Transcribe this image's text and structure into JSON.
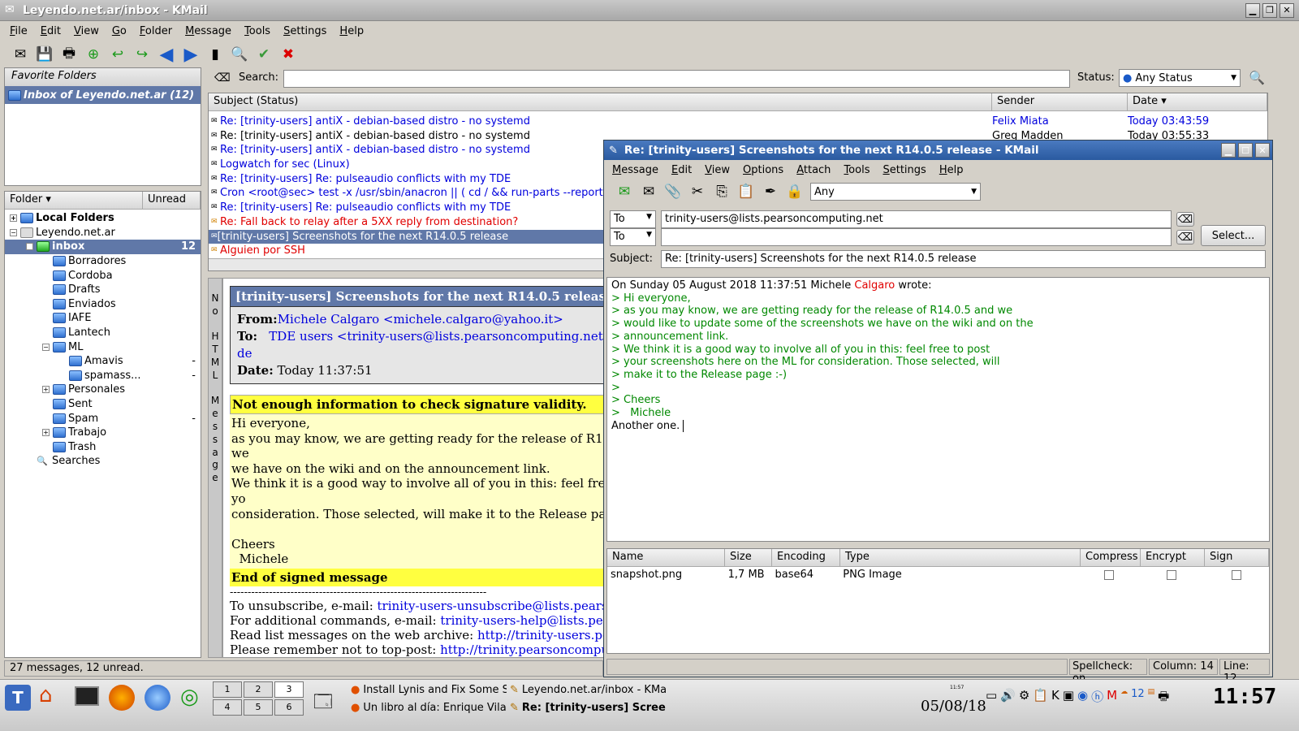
{
  "main_window": {
    "title": "Leyendo.net.ar/inbox - KMail",
    "menu": [
      "File",
      "Edit",
      "View",
      "Go",
      "Folder",
      "Message",
      "Tools",
      "Settings",
      "Help"
    ],
    "favorites_header": "Favorite Folders",
    "favorite_inbox": "Inbox of Leyendo.net.ar  (12)",
    "search_label": "Search:",
    "search_value": "",
    "status_label": "Status:",
    "status_value": "Any Status",
    "folder_header": "Folder",
    "unread_header": "Unread",
    "folders": [
      {
        "name": "Local Folders",
        "level": 0,
        "expander": "+",
        "unread": ""
      },
      {
        "name": "Leyendo.net.ar",
        "level": 0,
        "expander": "−",
        "unread": ""
      },
      {
        "name": "inbox",
        "level": 1,
        "expander": "−",
        "unread": "12"
      },
      {
        "name": "Borradores",
        "level": 2,
        "expander": "",
        "unread": ""
      },
      {
        "name": "Cordoba",
        "level": 2,
        "expander": "",
        "unread": ""
      },
      {
        "name": "Drafts",
        "level": 2,
        "expander": "",
        "unread": ""
      },
      {
        "name": "Enviados",
        "level": 2,
        "expander": "",
        "unread": ""
      },
      {
        "name": "IAFE",
        "level": 2,
        "expander": "",
        "unread": ""
      },
      {
        "name": "Lantech",
        "level": 2,
        "expander": "",
        "unread": ""
      },
      {
        "name": "ML",
        "level": 2,
        "expander": "−",
        "unread": ""
      },
      {
        "name": "Amavis",
        "level": 3,
        "expander": "",
        "unread": "-"
      },
      {
        "name": "spamass...",
        "level": 3,
        "expander": "",
        "unread": "-"
      },
      {
        "name": "Personales",
        "level": 2,
        "expander": "+",
        "unread": ""
      },
      {
        "name": "Sent",
        "level": 2,
        "expander": "",
        "unread": ""
      },
      {
        "name": "Spam",
        "level": 2,
        "expander": "",
        "unread": "-"
      },
      {
        "name": "Trabajo",
        "level": 2,
        "expander": "+",
        "unread": ""
      },
      {
        "name": "Trash",
        "level": 2,
        "expander": "",
        "unread": ""
      },
      {
        "name": "Searches",
        "level": 1,
        "expander": "",
        "unread": ""
      }
    ],
    "list_headers": {
      "subject": "Subject (Status)",
      "sender": "Sender",
      "date": "Date"
    },
    "messages": [
      {
        "subject": "Re: [trinity-users] antiX - debian-based distro - no systemd",
        "sender": "Felix Miata",
        "date": "Today 03:43:59",
        "style": "blue"
      },
      {
        "subject": "Re: [trinity-users] antiX - debian-based distro - no systemd",
        "sender": "Greg Madden",
        "date": "Today 03:55:33",
        "style": "black"
      },
      {
        "subject": "Re: [trinity-users] antiX - debian-based distro - no systemd",
        "sender": "",
        "date": "",
        "style": "blue"
      },
      {
        "subject": "Logwatch for sec (Linux)",
        "sender": "",
        "date": "",
        "style": "blue"
      },
      {
        "subject": "Re: [trinity-users] Re: pulseaudio conflicts with my TDE",
        "sender": "",
        "date": "",
        "style": "blue"
      },
      {
        "subject": "Cron <root@sec> test -x /usr/sbin/anacron || ( cd / && run-parts --report /e",
        "sender": "",
        "date": "",
        "style": "blue"
      },
      {
        "subject": "Re: [trinity-users] Re: pulseaudio conflicts with my TDE",
        "sender": "",
        "date": "",
        "style": "blue"
      },
      {
        "subject": "Re: Fall back to relay after a 5XX reply from destination?",
        "sender": "",
        "date": "",
        "style": "red"
      },
      {
        "subject": "[trinity-users] Screenshots for the next R14.0.5 release",
        "sender": "",
        "date": "",
        "style": "selected"
      },
      {
        "subject": "Alguien por SSH",
        "sender": "",
        "date": "",
        "style": "red"
      }
    ],
    "vertical_label": [
      "N",
      "o",
      "",
      "H",
      "T",
      "M",
      "L",
      "",
      "M",
      "e",
      "s",
      "s",
      "a",
      "g",
      "e"
    ],
    "reader": {
      "subject": "[trinity-users] Screenshots for the next R14.0.5 release",
      "from_label": "From:",
      "from_value": "Michele Calgaro <michele.calgaro@yahoo.it>",
      "to_label": "To:",
      "to_value": "TDE users <trinity-users@lists.pearsoncomputing.net>, TDE de",
      "date_label": "Date:",
      "date_value": "Today 11:37:51",
      "sig_warning": "Not enough information to check signature validity.",
      "body": [
        "Hi everyone,",
        "as you may know, we are getting ready for the release of R14.0.5 and we",
        "we have on the wiki and on the announcement link.",
        "We think it is a good way to involve all of you in this: feel free to post yo",
        "consideration. Those selected, will make it to the Release page"
      ],
      "cheers": "Cheers",
      "name": "  Michele",
      "sig_end": "End of signed message",
      "separator": "------------------------------------------------------------------------",
      "footer": [
        {
          "prefix": "To unsubscribe, e-mail: ",
          "link": "trinity-users-unsubscribe@lists.pearsoncomputin"
        },
        {
          "prefix": "For additional commands, e-mail: ",
          "link": "trinity-users-help@lists.pearsoncomputi"
        },
        {
          "prefix": "Read list messages on the web archive: ",
          "link": "http://trinity-users.pearsoncompu"
        },
        {
          "prefix": "Please remember not to top-post: ",
          "link": "http://trinity.pearsoncomputing.net/m"
        }
      ]
    },
    "status_bar": "27 messages, 12 unread."
  },
  "composer": {
    "title": "Re: [trinity-users] Screenshots for the next R14.0.5 release - KMail",
    "menu": [
      "Message",
      "Edit",
      "View",
      "Options",
      "Attach",
      "Tools",
      "Settings",
      "Help"
    ],
    "identity_value": "Any",
    "to1_type": "To",
    "to1_value": "trinity-users@lists.pearsoncomputing.net",
    "to2_type": "To",
    "to2_value": "",
    "select_button": "Select...",
    "subject_label": "Subject:",
    "subject_value": "Re: [trinity-users] Screenshots for the next R14.0.5 release",
    "body_intro_prefix": "On Sunday 05 August 2018 11:37:51 Michele ",
    "body_intro_name": "Calgaro",
    "body_intro_suffix": " wrote:",
    "quoted": [
      "> Hi everyone,",
      "> as you may know, we are getting ready for the release of R14.0.5 and we",
      "> would like to update some of the screenshots we have on the wiki and on the",
      "> announcement link.",
      "> We think it is a good way to involve all of you in this: feel free to post",
      "> your screenshots here on the ML for consideration. Those selected, will",
      "> make it to the Release page :-)",
      ">",
      "> Cheers",
      ">   Michele"
    ],
    "reply_line": "Another one.",
    "attach_headers": [
      "Name",
      "Size",
      "Encoding",
      "Type",
      "Compress",
      "Encrypt",
      "Sign"
    ],
    "attachments": [
      {
        "name": "snapshot.png",
        "size": "1,7 MB",
        "encoding": "base64",
        "type": "PNG Image"
      }
    ],
    "status": {
      "spellcheck": "Spellcheck: on",
      "column": "Column: 14",
      "line": "Line: 12"
    }
  },
  "taskbar": {
    "desktops": [
      "1",
      "2",
      "3",
      "4",
      "5",
      "6"
    ],
    "tasks": [
      {
        "label": "Install Lynis and Fix Some S",
        "bold": false
      },
      {
        "label": "Leyendo.net.ar/inbox - KMa",
        "bold": false
      },
      {
        "label": "Un libro al día: Enrique Vila",
        "bold": false
      },
      {
        "label": "Re: [trinity-users] Scree",
        "bold": true
      }
    ],
    "tray_count": "12",
    "date": "05/08/18",
    "small_time": "11:57",
    "clock": "11:57"
  },
  "colors": {
    "selection": "#6078a8",
    "unread": "#0000dd",
    "important": "#e00000",
    "quote": "#008800",
    "sig_yellow": "#ffff40"
  }
}
